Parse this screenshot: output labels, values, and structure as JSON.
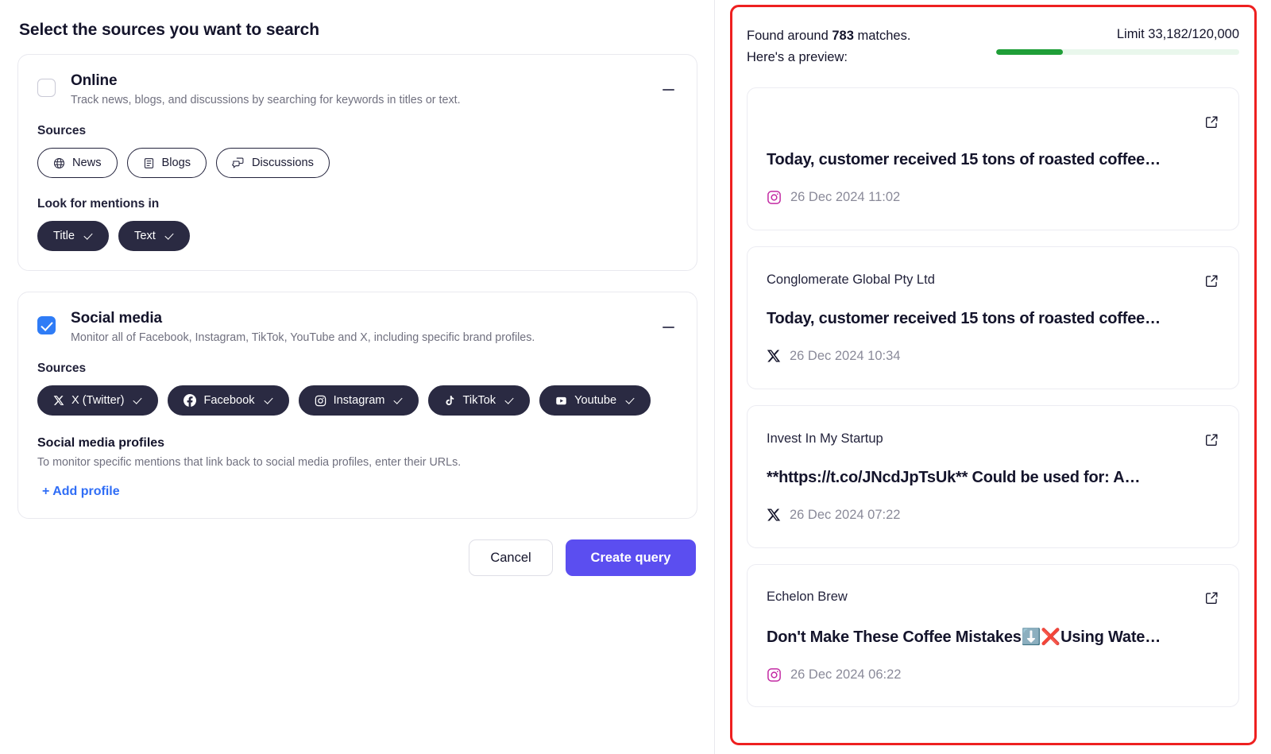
{
  "page_title": "Select the sources you want to search",
  "sections": [
    {
      "id": "online",
      "title": "Online",
      "subtitle": "Track news, blogs, and discussions by searching for keywords in titles or text.",
      "checked": false,
      "collapse_icon": "minus-icon",
      "sources_label": "Sources",
      "sources": [
        {
          "label": "News",
          "icon": "globe-icon",
          "selected": false
        },
        {
          "label": "Blogs",
          "icon": "document-icon",
          "selected": false
        },
        {
          "label": "Discussions",
          "icon": "chat-bubbles-icon",
          "selected": false
        }
      ],
      "mentions_label": "Look for mentions in",
      "mentions": [
        {
          "label": "Title",
          "selected": true
        },
        {
          "label": "Text",
          "selected": true
        }
      ]
    },
    {
      "id": "social-media",
      "title": "Social media",
      "subtitle": "Monitor all of Facebook, Instagram, TikTok, YouTube and X, including specific brand profiles.",
      "checked": true,
      "collapse_icon": "minus-icon",
      "sources_label": "Sources",
      "sources": [
        {
          "label": "X (Twitter)",
          "icon": "x-twitter-icon",
          "selected": true
        },
        {
          "label": "Facebook",
          "icon": "facebook-icon",
          "selected": true
        },
        {
          "label": "Instagram",
          "icon": "instagram-icon",
          "selected": true
        },
        {
          "label": "TikTok",
          "icon": "tiktok-icon",
          "selected": true
        },
        {
          "label": "Youtube",
          "icon": "youtube-icon",
          "selected": true
        }
      ],
      "profiles_heading": "Social media profiles",
      "profiles_sub": "To monitor specific mentions that link back to social media profiles, enter their URLs.",
      "add_profile_label": "+ Add profile"
    }
  ],
  "footer": {
    "cancel_label": "Cancel",
    "create_label": "Create query"
  },
  "preview": {
    "summary_line1_prefix": "Found around ",
    "summary_count": "783",
    "summary_line1_suffix": " matches.",
    "summary_line2": "Here's a preview:",
    "limit_label": "Limit 33,182/120,000",
    "limit_used": 33182,
    "limit_total": 120000,
    "limit_percent": 27.6,
    "limit_color": "#1f9e38",
    "border_color": "#ee2020",
    "results": [
      {
        "author": "",
        "title": "Today, customer received 15 tons of roasted coffee…",
        "source": "instagram-icon",
        "date": "26 Dec 2024 11:02",
        "ext_icon": "external-link-icon"
      },
      {
        "author": "Conglomerate Global Pty Ltd",
        "title": "Today, customer received 15 tons of roasted coffee…",
        "source": "x-twitter-icon",
        "date": "26 Dec 2024 10:34",
        "ext_icon": "external-link-icon"
      },
      {
        "author": "Invest In My Startup",
        "title": "**https://t.co/JNcdJpTsUk** Could be used for: A…",
        "source": "x-twitter-icon",
        "date": "26 Dec 2024 07:22",
        "ext_icon": "external-link-icon"
      },
      {
        "author": "Echelon Brew",
        "title": "Don't Make These Coffee Mistakes⬇️❌Using Wate…",
        "source": "instagram-icon",
        "date": "26 Dec 2024 06:22",
        "ext_icon": "external-link-icon"
      }
    ]
  }
}
